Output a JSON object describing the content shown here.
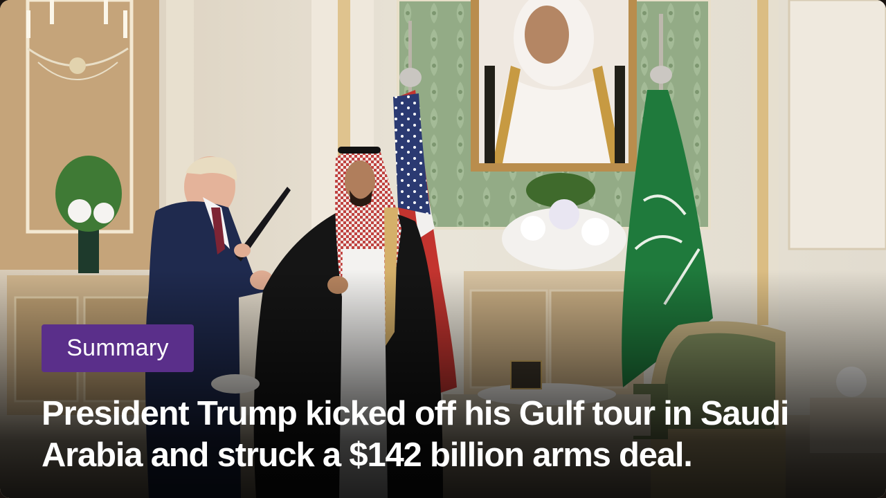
{
  "badge": {
    "label": "Summary"
  },
  "headline": {
    "text": "President Trump kicked off his Gulf tour in Saudi Arabia and struck a $142 billion arms deal."
  },
  "colors": {
    "badge_background": "#5a2f8a",
    "headline_text": "#ffffff",
    "saudi_flag_green": "#1f7a3c",
    "wall_green": "#8aa57c"
  },
  "photo": {
    "scene": "ceremonial-handshake",
    "elements": [
      "chandelier-icon",
      "portrait-frame",
      "us-flag",
      "saudi-flag",
      "flower-arrangement",
      "armchair",
      "ornate-cabinet"
    ]
  }
}
